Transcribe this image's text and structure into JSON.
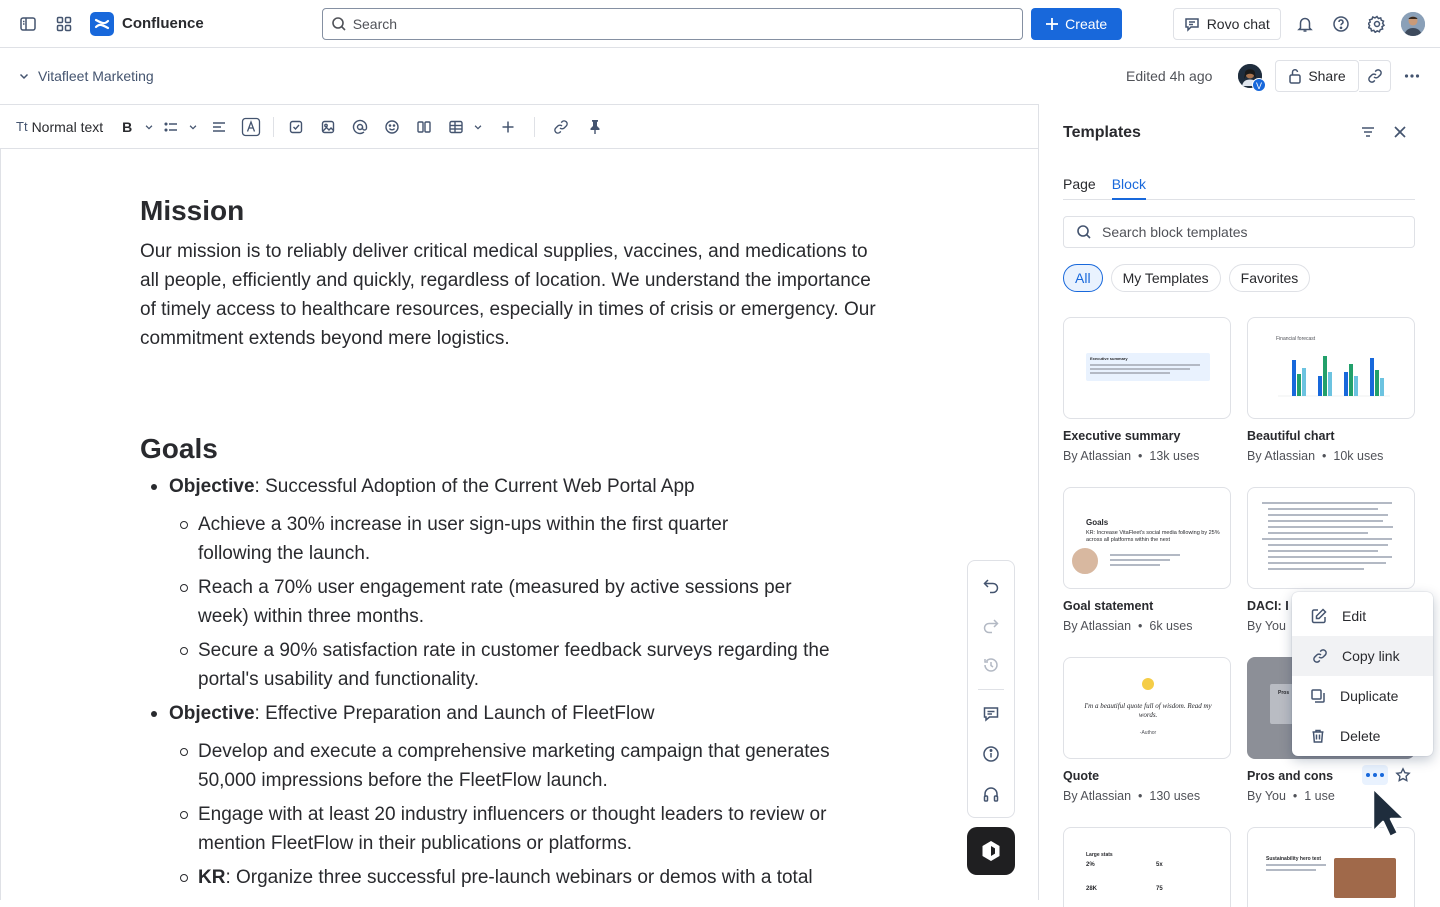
{
  "topbar": {
    "app_name": "Confluence",
    "search_placeholder": "Search",
    "create_label": "Create",
    "rovo_label": "Rovo chat"
  },
  "page": {
    "space_name": "Vitafleet Marketing",
    "edited": "Edited 4h ago",
    "share_label": "Share",
    "collaborator_badge": "V"
  },
  "toolbar": {
    "text_style": "Normal text",
    "bold": "B"
  },
  "doc": {
    "h_mission": "Mission",
    "mission_text": "Our mission is to reliably deliver critical medical supplies, vaccines, and medications to all people, efficiently and quickly, regardless of location. We understand the importance of timely access to healthcare resources, especially in times of crisis or emergency. Our commitment extends beyond mere logistics.",
    "h_goals": "Goals",
    "obj1_label": "Objective",
    "obj1_text": ": Successful Adoption of the Current Web Portal App",
    "obj1_items": [
      "Achieve a 30% increase in user sign-ups within the first quarter following the launch.",
      "Reach a 70% user engagement rate (measured by active sessions per week) within three months.",
      "Secure a 90% satisfaction rate in customer feedback surveys regarding the portal's usability and functionality."
    ],
    "obj2_label": "Objective",
    "obj2_text": ": Effective Preparation and Launch of FleetFlow",
    "obj2_items": [
      "Develop and execute a comprehensive marketing campaign that generates 50,000 impressions before the FleetFlow launch.",
      "Engage with at least 20 industry influencers or thought leaders to review or mention FleetFlow in their publications or platforms."
    ],
    "kr_label": "KR",
    "kr_text": ": Organize three successful pre-launch webinars or demos with a total"
  },
  "panel": {
    "title": "Templates",
    "tabs": [
      "Page",
      "Block"
    ],
    "search_placeholder": "Search block templates",
    "chips": [
      "All",
      "My Templates",
      "Favorites"
    ],
    "cards": [
      {
        "name": "Executive summary",
        "by": "By Atlassian",
        "uses": "13k uses",
        "thumb_text": "Executive summary"
      },
      {
        "name": "Beautiful chart",
        "by": "By Atlassian",
        "uses": "10k uses",
        "thumb_text": "Financial forecast"
      },
      {
        "name": "Goal statement",
        "by": "By Atlassian",
        "uses": "6k uses",
        "thumb_text": "Goals"
      },
      {
        "name": "DACI: I",
        "by": "By You",
        "uses": ""
      },
      {
        "name": "Quote",
        "by": "By Atlassian",
        "uses": "130 uses",
        "thumb_text": "I'm a beautiful quote full of wisdom. Read my words."
      },
      {
        "name": "Pros and cons",
        "by": "By You",
        "uses": "1 use",
        "thumb_text": "Pros"
      },
      {
        "name": "",
        "by": "",
        "uses": "",
        "thumb_text": "Large stats"
      },
      {
        "name": "",
        "by": "",
        "uses": "",
        "thumb_text": "Sustainability hero text"
      }
    ],
    "thumb_extra": {
      "quote_author": "-Author",
      "goal_kr": "KR: Increase VitaFleet's social media following by 25% across all platforms within the next",
      "stats": [
        "2%",
        "5x",
        "28K",
        "75"
      ]
    }
  },
  "context_menu": {
    "items": [
      "Edit",
      "Copy link",
      "Duplicate",
      "Delete"
    ]
  },
  "colors": {
    "brand": "#1868db",
    "text": "#292a2e",
    "border": "#dfe1e6"
  }
}
